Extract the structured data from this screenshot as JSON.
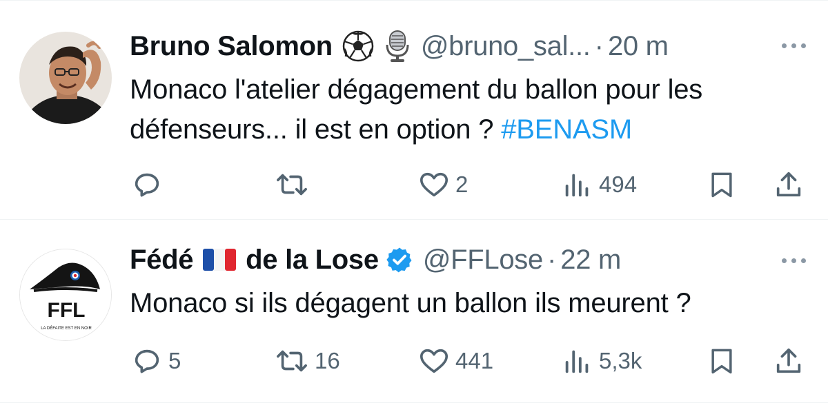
{
  "tweets": [
    {
      "name": "Bruno Salomon",
      "emojis": [
        "⚽",
        "🎙️"
      ],
      "handle": "@bruno_sal...",
      "separator": "·",
      "time": "20 m",
      "text_main": "Monaco l'atelier dégagement du ballon pour les défenseurs... il est en option ? ",
      "hashtag": "#BENASM",
      "stats": {
        "replies": "",
        "retweets": "",
        "likes": "2",
        "views": "494"
      }
    },
    {
      "name_part1": "Fédé",
      "flag": "🇫🇷",
      "name_part2": "de la Lose",
      "verified": true,
      "handle": "@FFLose",
      "separator": "·",
      "time": "22 m",
      "text_main": "Monaco si ils dégagent un ballon ils meurent ?",
      "avatar_text": "FFL",
      "avatar_caption": "LA DÉFAITE EST EN NOIR",
      "stats": {
        "replies": "5",
        "retweets": "16",
        "likes": "441",
        "views": "5,3k"
      }
    }
  ],
  "colors": {
    "text": "#0f1419",
    "secondary": "#536471",
    "link": "#1d9bf0",
    "verified": "#1d9bf0"
  },
  "icons": [
    "reply-icon",
    "retweet-icon",
    "like-icon",
    "views-icon",
    "bookmark-icon",
    "share-icon",
    "more-icon",
    "verified-icon"
  ]
}
